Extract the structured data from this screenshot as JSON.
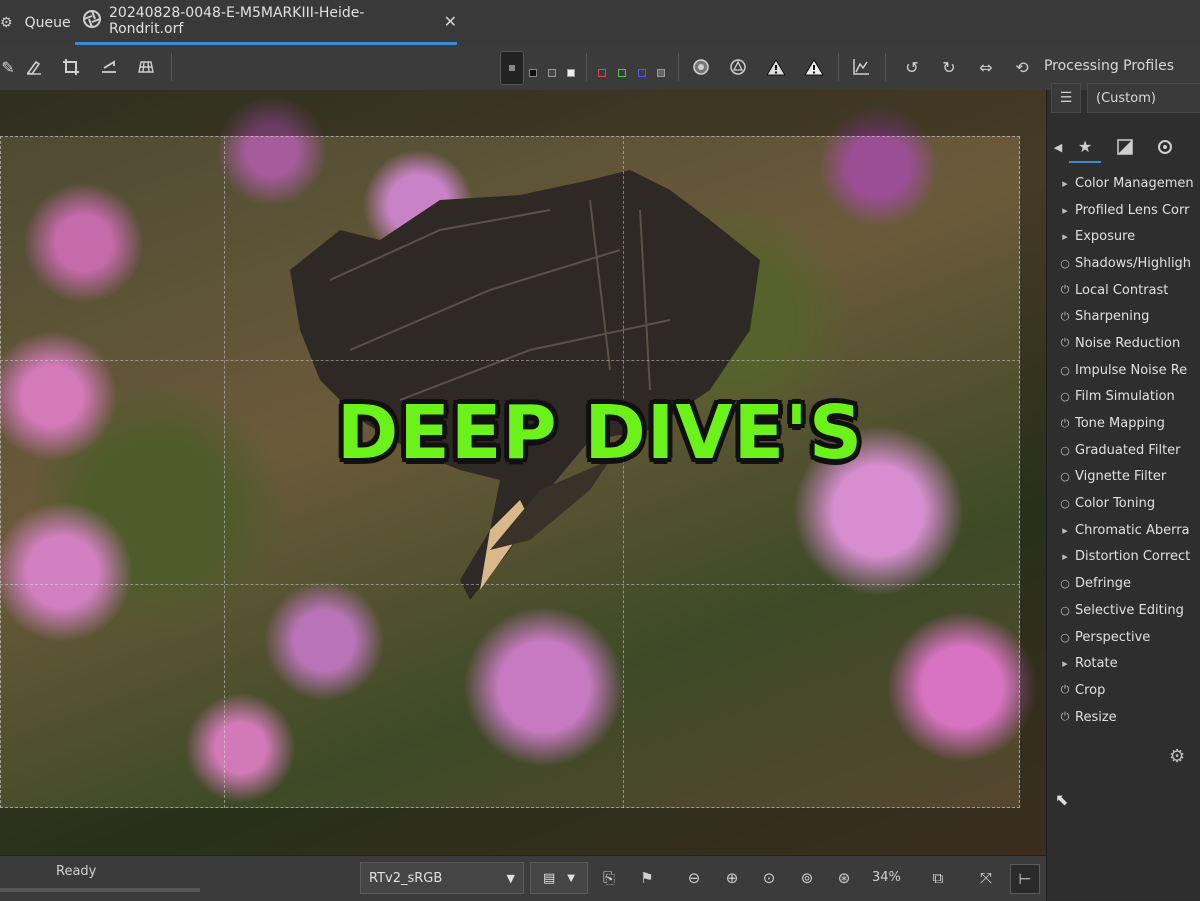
{
  "tabs": {
    "queue_label": "Queue",
    "file_label": "20240828-0048-E-M5MARKIII-Heide-Rondrit.orf",
    "close_symbol": "✕"
  },
  "toolbar": {
    "panel_title": "Processing Profiles",
    "icons": [
      "edit-icon",
      "hand-icon",
      "crop-icon",
      "straighten-icon",
      "grid-icon",
      "preview-bg-icon",
      "clip-icon",
      "focus-mask-icon",
      "highlight-warning-icon",
      "shadow-warning-icon",
      "histogram-icon",
      "rotate-left-icon",
      "rotate-right-icon",
      "flip-h-icon",
      "flip-v-icon"
    ]
  },
  "profile": {
    "value": "(Custom)"
  },
  "overlay": {
    "headline": "DEEP DIVE'S"
  },
  "tools": [
    {
      "label": "Color Managemen",
      "kind": "expand"
    },
    {
      "label": "Profiled Lens Corr",
      "kind": "expand"
    },
    {
      "label": "Exposure",
      "kind": "expand"
    },
    {
      "label": "Shadows/Highligh",
      "kind": "power-off"
    },
    {
      "label": "Local Contrast",
      "kind": "power-on"
    },
    {
      "label": "Sharpening",
      "kind": "power-on"
    },
    {
      "label": "Noise Reduction",
      "kind": "power-on"
    },
    {
      "label": "Impulse Noise Re",
      "kind": "power-off"
    },
    {
      "label": "Film Simulation",
      "kind": "power-off"
    },
    {
      "label": "Tone Mapping",
      "kind": "power-on"
    },
    {
      "label": "Graduated Filter",
      "kind": "power-off"
    },
    {
      "label": "Vignette Filter",
      "kind": "power-off"
    },
    {
      "label": "Color Toning",
      "kind": "power-off"
    },
    {
      "label": "Chromatic Aberra",
      "kind": "expand"
    },
    {
      "label": "Distortion Correct",
      "kind": "expand"
    },
    {
      "label": "Defringe",
      "kind": "power-off"
    },
    {
      "label": "Selective Editing",
      "kind": "power-off"
    },
    {
      "label": "Perspective",
      "kind": "power-off"
    },
    {
      "label": "Rotate",
      "kind": "expand"
    },
    {
      "label": "Crop",
      "kind": "power-on"
    },
    {
      "label": "Resize",
      "kind": "power-on"
    }
  ],
  "status": {
    "text": "Ready",
    "output_profile": "RTv2_sRGB",
    "zoom": "34%"
  },
  "colors": {
    "accent": "#3a8ad6",
    "headline_fill": "#6bf21a",
    "headline_outline": "#101010"
  }
}
